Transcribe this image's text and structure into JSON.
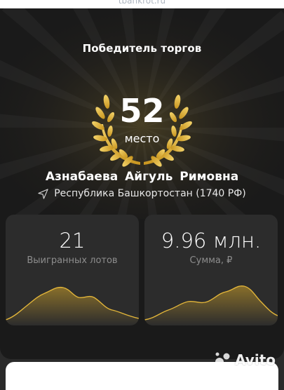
{
  "browser": {
    "url": "tbankrot.ru"
  },
  "card": {
    "title": "Победитель торгов",
    "place_number": "52",
    "place_label": "место",
    "winner_name": "Азнабаева Айгуль Римовна",
    "region_icon": "navigation-arrow-icon",
    "region": "Республика Башкортостан (1740 РФ)"
  },
  "stats": [
    {
      "value": "21",
      "label": "Выигранных лотов"
    },
    {
      "value": "9.96 млн.",
      "label": "Сумма, ₽"
    }
  ],
  "watermark": {
    "text": "Avito",
    "icon": "avito-logo-icon"
  },
  "colors": {
    "background": "#1a1a1a",
    "panel": "#2c2c2c",
    "gold": "#d4a62a",
    "gold_light": "#f3d36a",
    "label_gray": "#8d8d8d"
  }
}
